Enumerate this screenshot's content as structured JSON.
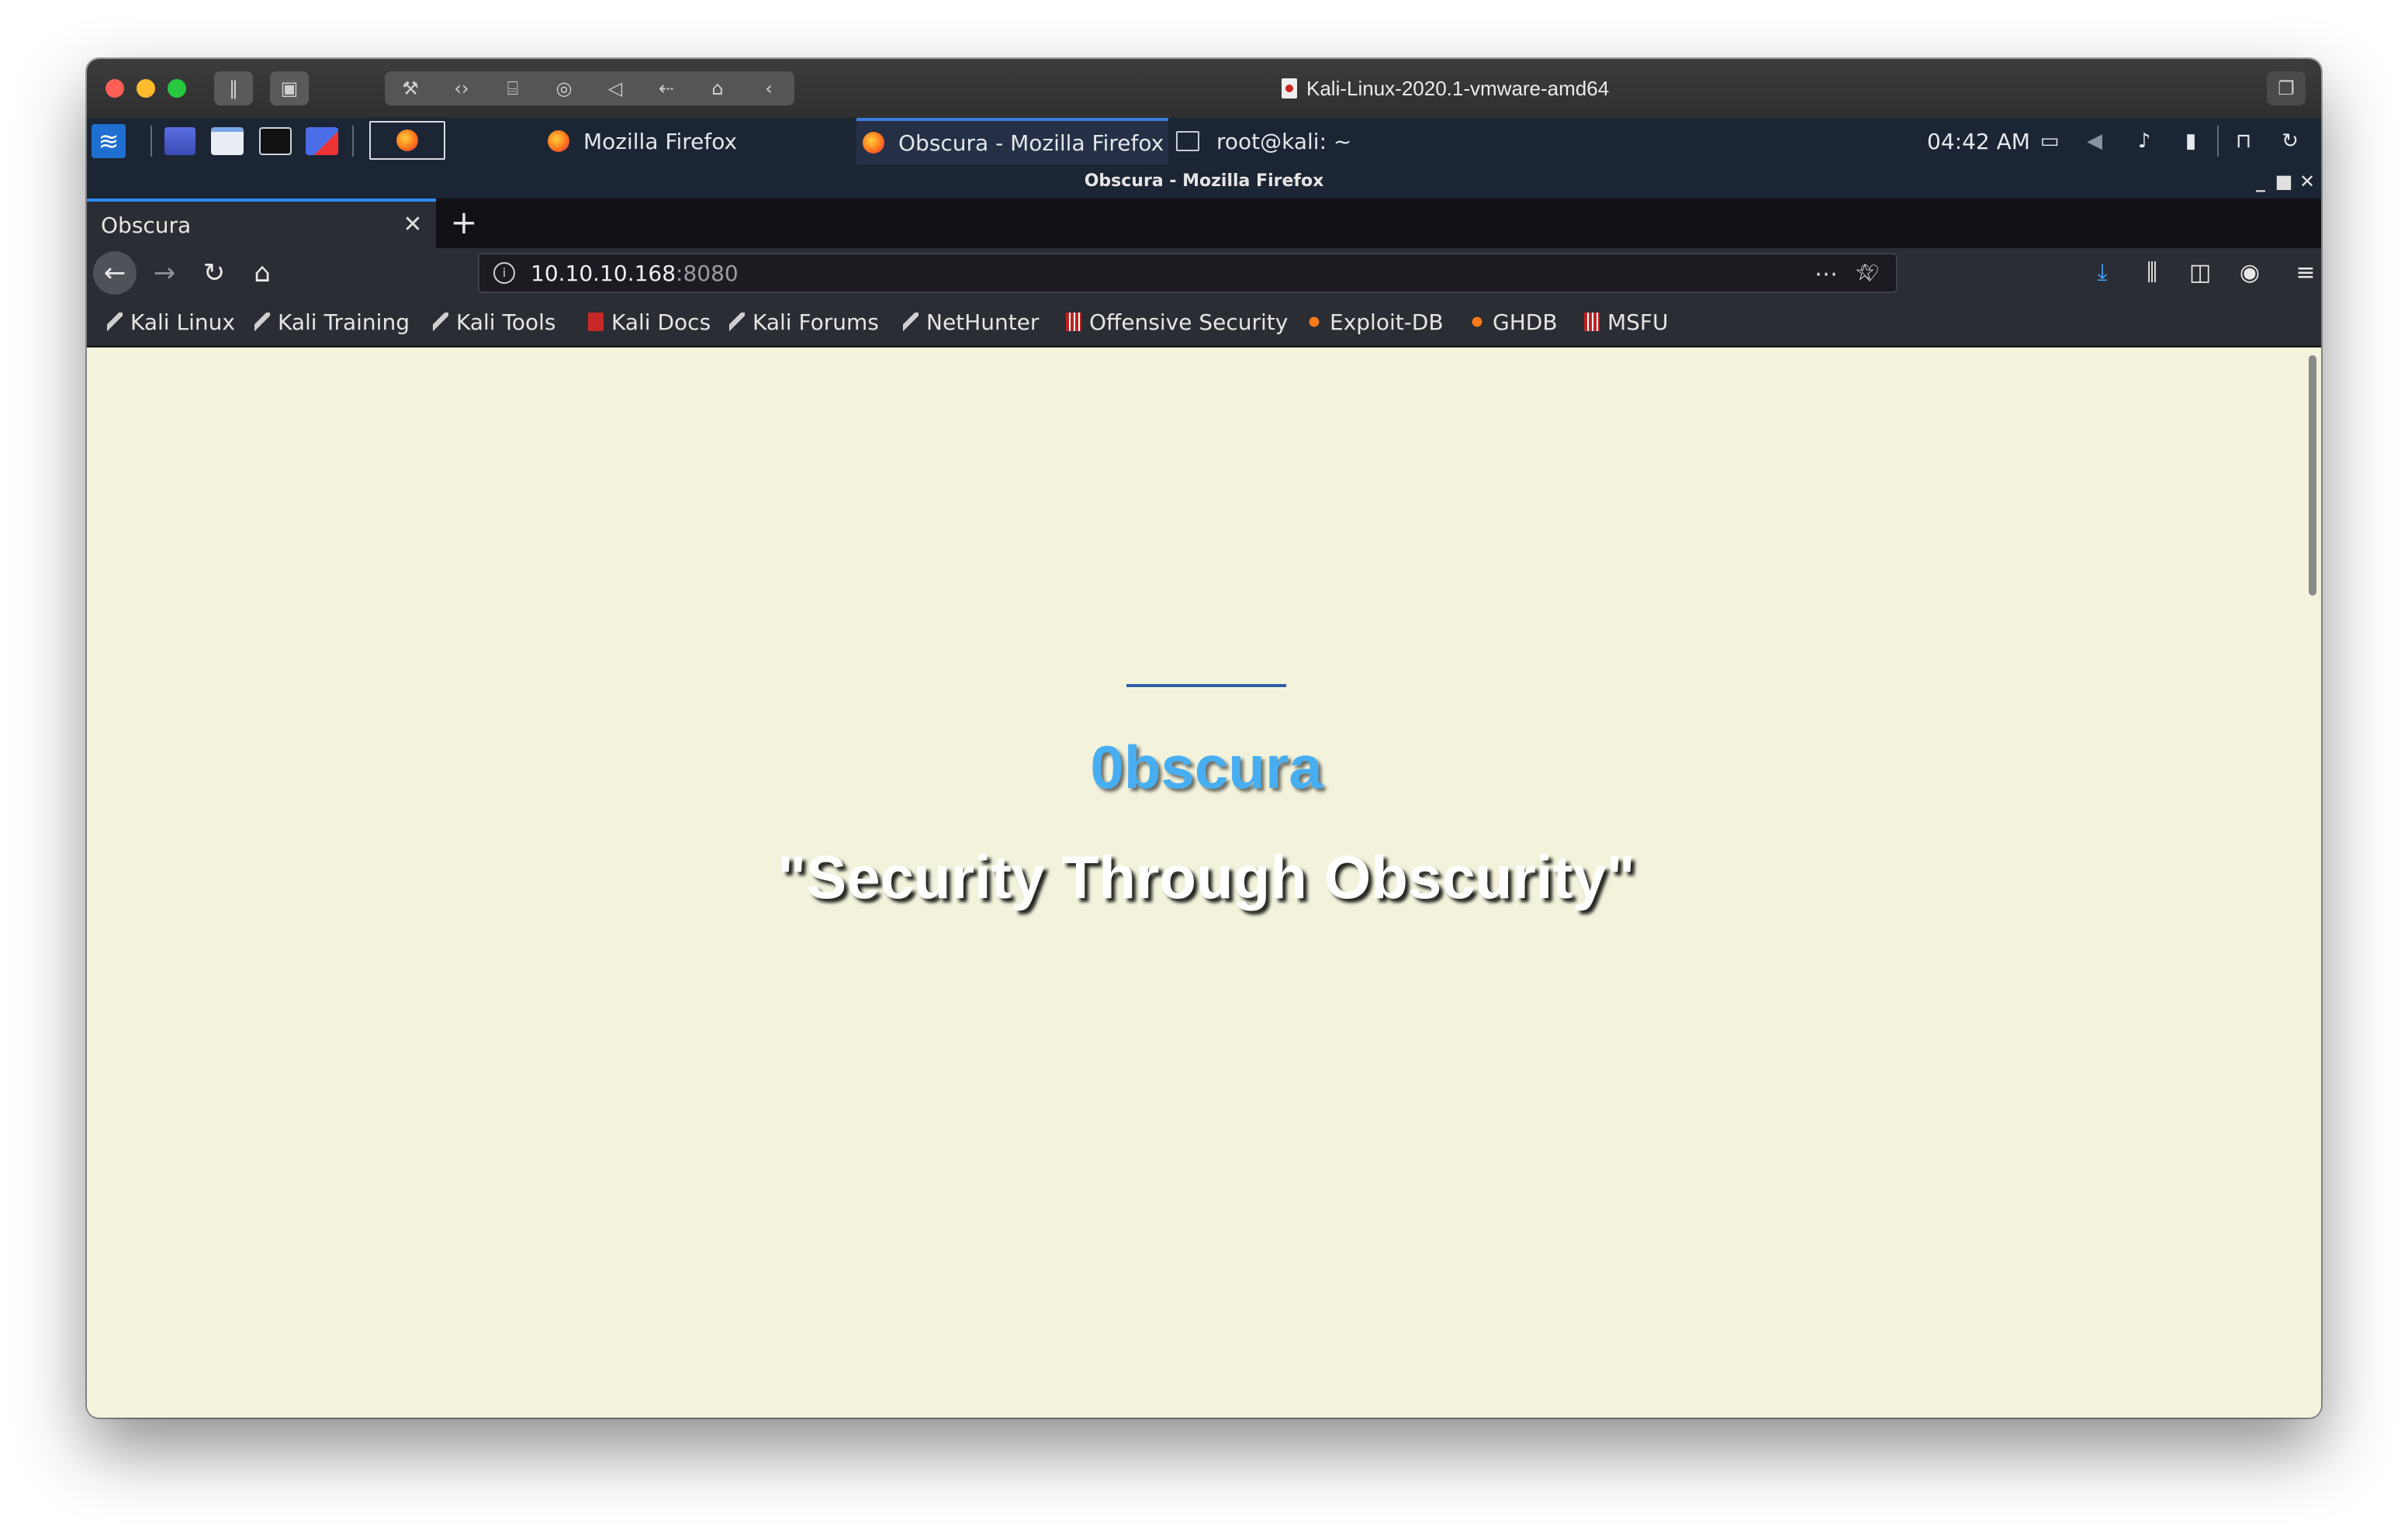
{
  "vm": {
    "title": "Kali-Linux-2020.1-vmware-amd64"
  },
  "taskbar": {
    "tasks": [
      {
        "label": "Mozilla Firefox",
        "icon": "firefox-icon"
      },
      {
        "label": "Obscura - Mozilla Firefox",
        "icon": "firefox-icon",
        "active": true
      },
      {
        "label": "root@kali: ~",
        "icon": "terminal-icon"
      }
    ],
    "clock": "04:42 AM"
  },
  "firefox": {
    "window_title": "Obscura - Mozilla Firefox",
    "tab": {
      "label": "Obscura"
    },
    "url": {
      "host": "10.10.10.168",
      "port": ":8080"
    },
    "bookmarks": [
      {
        "label": "Kali Linux",
        "icon": "kali-dragon-icon"
      },
      {
        "label": "Kali Training",
        "icon": "kali-dragon-icon"
      },
      {
        "label": "Kali Tools",
        "icon": "kali-dragon-icon"
      },
      {
        "label": "Kali Docs",
        "icon": "kali-docs-icon"
      },
      {
        "label": "Kali Forums",
        "icon": "kali-dragon-icon"
      },
      {
        "label": "NetHunter",
        "icon": "nethunter-icon"
      },
      {
        "label": "Offensive Security",
        "icon": "offsec-icon"
      },
      {
        "label": "Exploit-DB",
        "icon": "exploitdb-icon"
      },
      {
        "label": "GHDB",
        "icon": "ghdb-icon"
      },
      {
        "label": "MSFU",
        "icon": "offsec-icon"
      }
    ]
  },
  "page": {
    "title": "0bscura",
    "tagline": "\"Security Through Obscurity\"",
    "colors": {
      "background": "#f3f3dc",
      "title": "#48aef2",
      "accent_line": "#2f5fa7"
    }
  }
}
